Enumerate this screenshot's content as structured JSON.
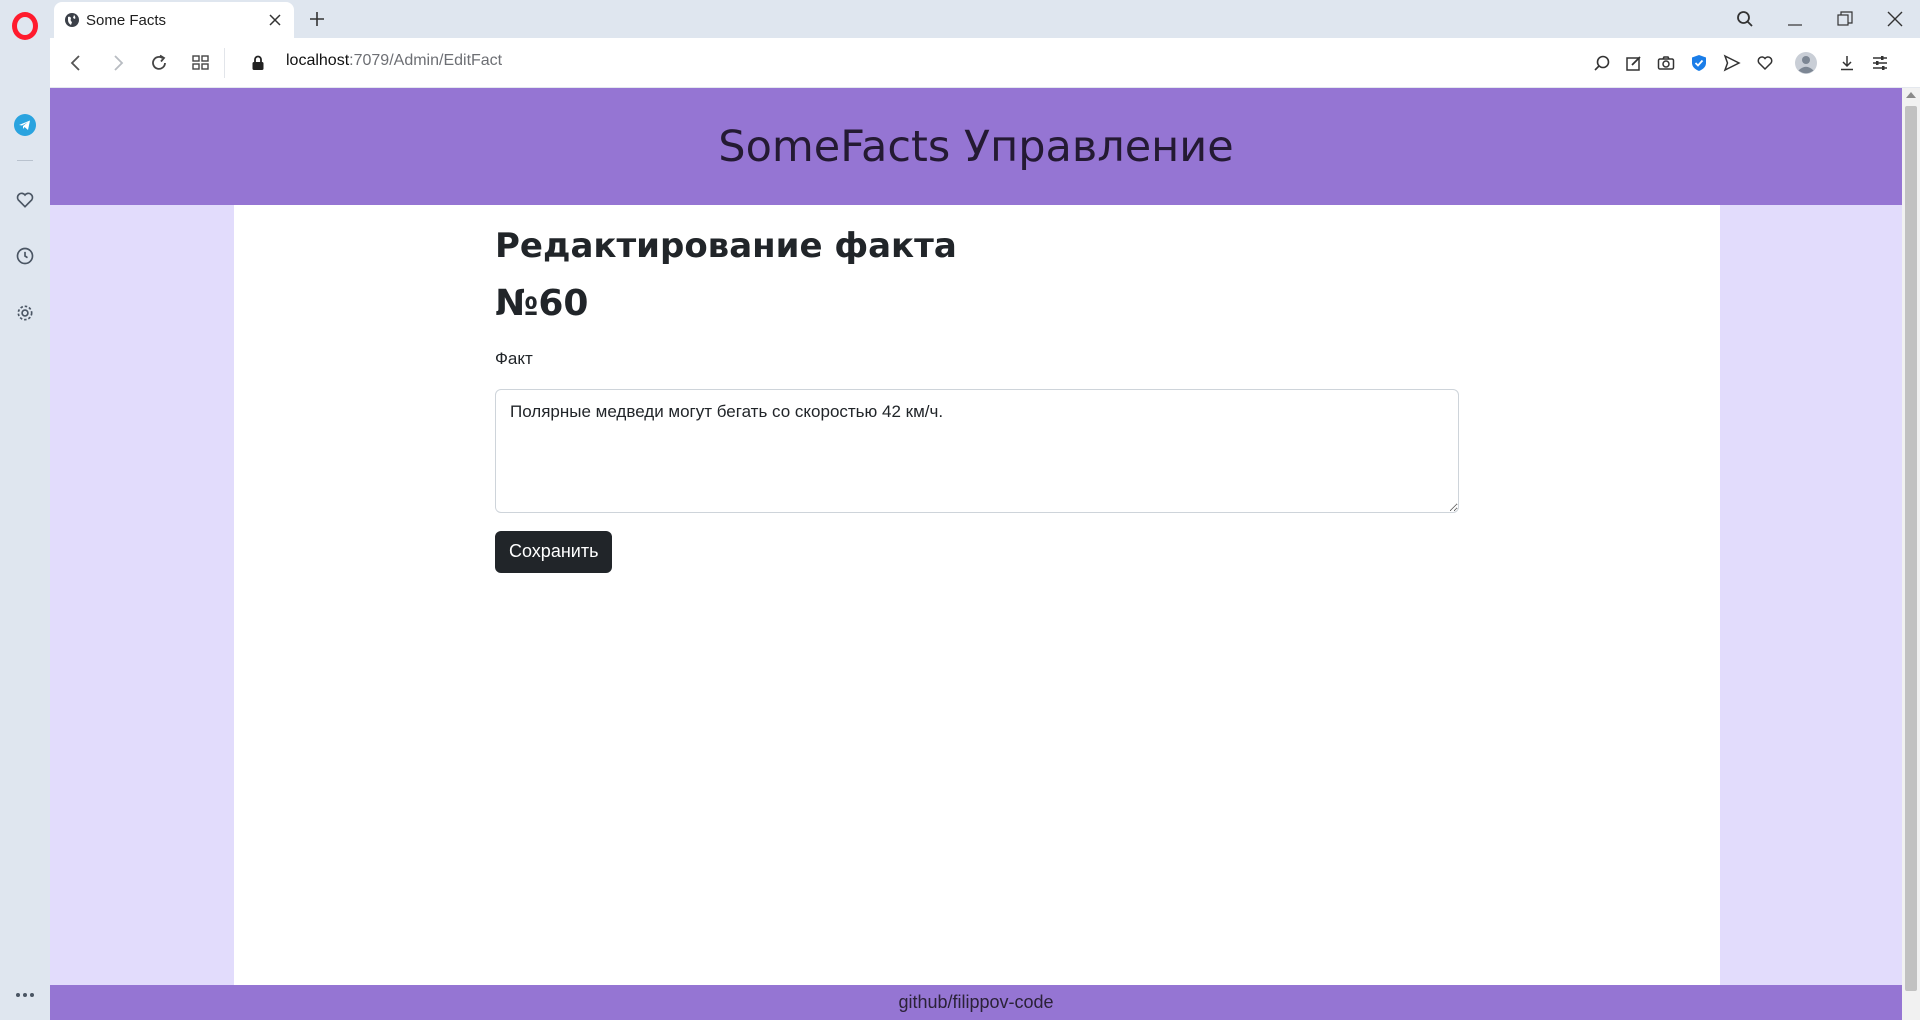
{
  "browser": {
    "tab_title": "Some Facts",
    "url_host": "localhost",
    "url_path": ":7079/Admin/EditFact",
    "icons": [
      "opera-logo-icon",
      "telegram-icon",
      "heart-icon",
      "clock-icon",
      "gear-icon",
      "more-icon",
      "globe-icon",
      "close-icon",
      "plus-icon",
      "search-icon",
      "minimize-icon",
      "restore-icon",
      "back-icon",
      "forward-icon",
      "reload-icon",
      "tab-grid-icon",
      "lock-icon",
      "lens-icon",
      "snapshot-edit-icon",
      "camera-icon",
      "shield-icon",
      "send-icon",
      "heart-icon",
      "profile-icon",
      "download-icon",
      "settings-sliders-icon"
    ]
  },
  "site": {
    "header_title": "SomeFacts Управление",
    "footer_text": "github/filippov-code"
  },
  "form": {
    "heading": "Редактирование факта",
    "number": "№60",
    "fact_label": "Факт",
    "fact_value": "Полярные медведи могут бегать со скоростью 42 км/ч.",
    "save_label": "Сохранить"
  },
  "colors": {
    "header_bg": "#9575d3",
    "page_bg": "#e2dcfc",
    "button_bg": "#212529",
    "opera_red": "#ff1b2d"
  }
}
